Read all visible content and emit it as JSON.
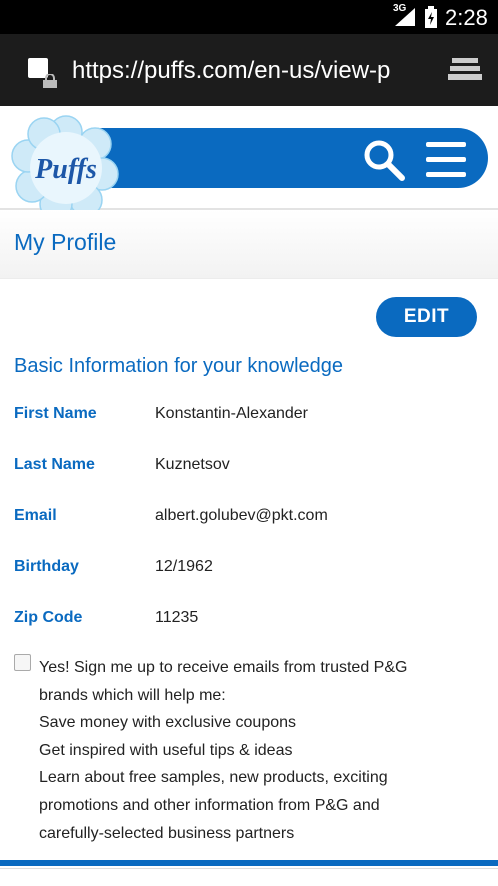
{
  "status_bar": {
    "network": "3G",
    "time": "2:28"
  },
  "browser": {
    "url": "https://puffs.com/en-us/view-p"
  },
  "header": {
    "brand": "Puffs"
  },
  "page": {
    "title": "My Profile",
    "edit_label": "EDIT",
    "section_title": "Basic Information for your knowledge"
  },
  "profile": {
    "fields": [
      {
        "label": "First Name",
        "value": "Konstantin-Alexander"
      },
      {
        "label": "Last Name",
        "value": "Kuznetsov"
      },
      {
        "label": "Email",
        "value": "albert.golubev@pkt.com"
      },
      {
        "label": "Birthday",
        "value": "12/1962"
      },
      {
        "label": "Zip Code",
        "value": "11235"
      }
    ]
  },
  "optin": {
    "checked": false,
    "lines": [
      "Yes! Sign me up to receive emails from trusted P&G",
      "brands which will help me:",
      "Save money with exclusive coupons",
      "Get inspired with useful tips & ideas",
      "Learn about free samples, new products, exciting",
      "promotions and other information from P&G and",
      "carefully-selected business partners"
    ]
  },
  "colors": {
    "brand_blue": "#0a6ac0",
    "statusbar": "#000000",
    "urlbar": "#1c1c1c"
  },
  "icons": [
    "signal-icon",
    "battery-icon",
    "favicon-icon",
    "lock-icon",
    "tabs-icon",
    "search-icon",
    "menu-icon"
  ]
}
